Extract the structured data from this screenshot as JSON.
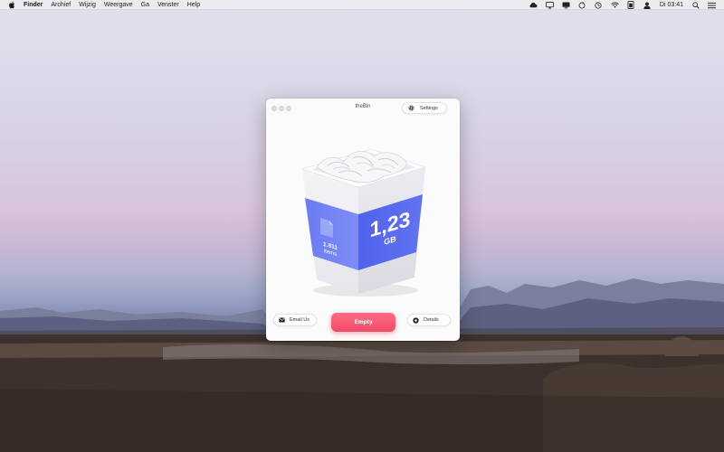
{
  "menubar": {
    "app_name": "Finder",
    "items": [
      "Archief",
      "Wijzig",
      "Weergave",
      "Ga",
      "Venster",
      "Help"
    ],
    "clock": "Di 03:41"
  },
  "window": {
    "title": "theBin",
    "settings_label": "Settings",
    "bin": {
      "size_value": "1,23",
      "size_unit": "GB",
      "items_count": "1.811",
      "items_label": "items"
    },
    "email_label": "Email Us",
    "empty_label": "Empty",
    "details_label": "Details"
  },
  "colors": {
    "accent_empty": "#f04b67",
    "bin_label": "#5b6ef0"
  },
  "icons": {
    "settings": "gear-icon",
    "email": "envelope-icon",
    "details": "info-icon"
  }
}
